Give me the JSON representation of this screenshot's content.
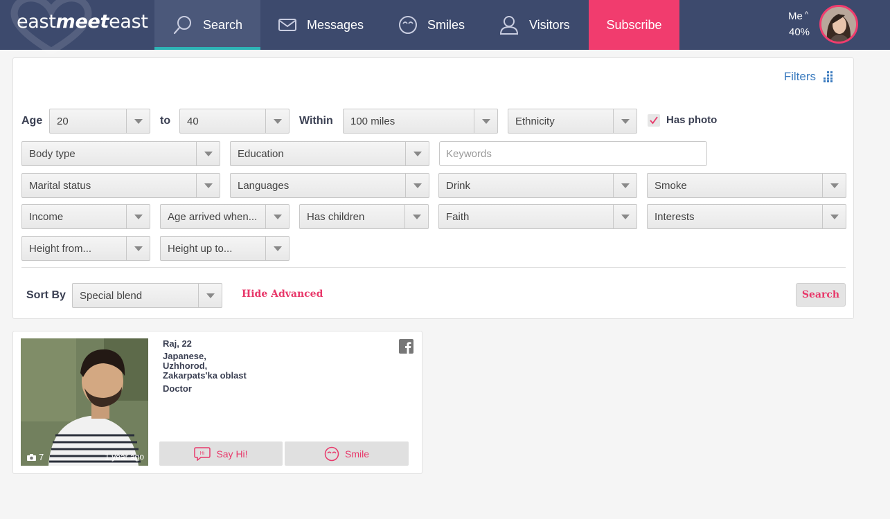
{
  "header": {
    "logo": {
      "part1": "east",
      "part2": "meet",
      "part3": "east"
    },
    "nav": {
      "search": "Search",
      "messages": "Messages",
      "smiles": "Smiles",
      "visitors": "Visitors",
      "subscribe": "Subscribe"
    },
    "me": {
      "label": "Me",
      "caret": "^",
      "percent": "40%"
    },
    "colors": {
      "bar": "#3d4a6d",
      "active_underline": "#2eb5b7",
      "subscribe": "#f13c6e"
    }
  },
  "search_form": {
    "filters_link": "Filters",
    "age_label": "Age",
    "age_from": "20",
    "to_label": "to",
    "age_to": "40",
    "within_label": "Within",
    "distance": "100 miles",
    "ethnicity": "Ethnicity",
    "has_photo_label": "Has photo",
    "has_photo_checked": true,
    "body_type": "Body type",
    "education": "Education",
    "keywords_placeholder": "Keywords",
    "marital_status": "Marital status",
    "languages": "Languages",
    "drink": "Drink",
    "smoke": "Smoke",
    "income": "Income",
    "age_arrived": "Age arrived when...",
    "has_children": "Has children",
    "faith": "Faith",
    "interests": "Interests",
    "height_from": "Height from...",
    "height_to": "Height up to...",
    "sort_label": "Sort By",
    "sort_value": "Special blend",
    "hide_advanced": "Hide Advanced",
    "search_button": "Search"
  },
  "results": [
    {
      "name_age": "Raj, 22",
      "location_line1": "Japanese,",
      "location_line2": "Uzhhorod,",
      "location_line3": "Zakarpats'ka oblast",
      "occupation": "Doctor",
      "photo_count": "7",
      "posted": "1 year ago",
      "say_hi": "Say Hi!",
      "say_hi_icon_text": "Hi",
      "smile": "Smile"
    }
  ]
}
